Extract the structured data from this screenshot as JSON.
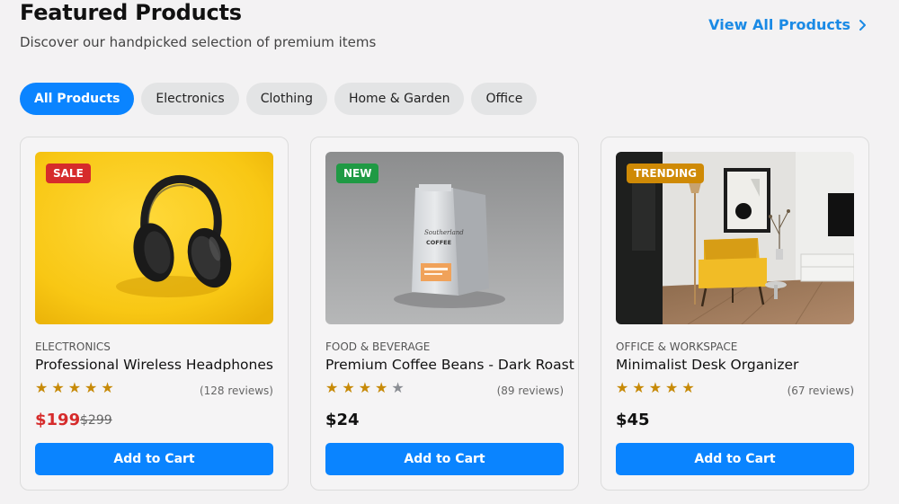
{
  "header": {
    "title": "Featured Products",
    "subtitle": "Discover our handpicked selection of premium items",
    "view_all_label": "View All Products",
    "view_all_icon": "chevron-right-icon"
  },
  "filters": [
    {
      "label": "All Products",
      "active": true
    },
    {
      "label": "Electronics",
      "active": false
    },
    {
      "label": "Clothing",
      "active": false
    },
    {
      "label": "Home & Garden",
      "active": false
    },
    {
      "label": "Office",
      "active": false
    }
  ],
  "products": [
    {
      "badge": "SALE",
      "badge_color": "#d62b2b",
      "category": "Electronics",
      "name": "Professional Wireless Headphones",
      "rating": 5,
      "reviews": "(128 reviews)",
      "price": "$199",
      "old_price": "$299",
      "cart_label": "Add to Cart",
      "image": "headphones-image"
    },
    {
      "badge": "NEW",
      "badge_color": "#1f9a44",
      "category": "Food & Beverage",
      "name": "Premium Coffee Beans - Dark Roast",
      "rating": 4,
      "reviews": "(89 reviews)",
      "price": "$24",
      "old_price": "",
      "cart_label": "Add to Cart",
      "image": "coffee-bag-image",
      "bag_text_1": "Southerland",
      "bag_text_2": "COFFEE"
    },
    {
      "badge": "TRENDING",
      "badge_color": "#cf8a06",
      "category": "Office & Workspace",
      "name": "Minimalist Desk Organizer",
      "rating": 5,
      "reviews": "(67 reviews)",
      "price": "$45",
      "old_price": "",
      "cart_label": "Add to Cart",
      "image": "living-room-image"
    }
  ],
  "colors": {
    "accent": "#0a84ff",
    "link": "#1a8ae5",
    "sale_price": "#d62b2b",
    "star": "#c78a08",
    "star_off": "#8b8e94"
  }
}
